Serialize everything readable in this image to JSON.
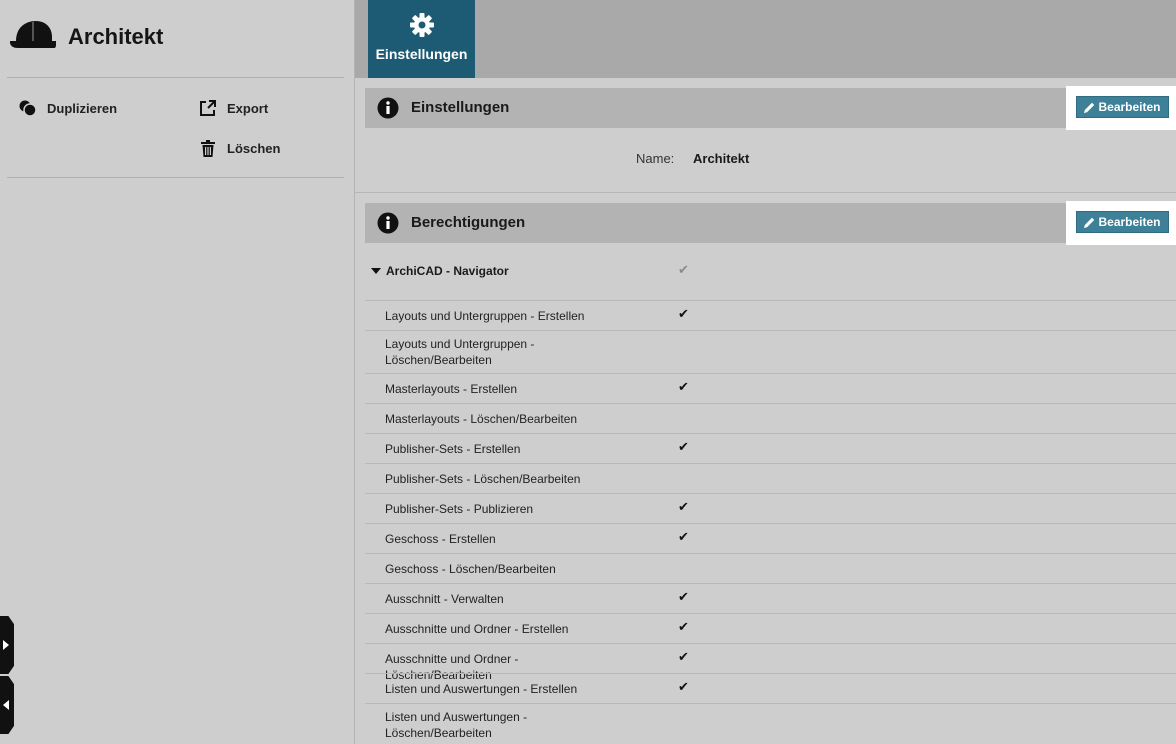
{
  "sidebar": {
    "title": "Architekt",
    "actions": {
      "duplicate": "Duplizieren",
      "export": "Export",
      "delete": "Löschen"
    }
  },
  "tabs": [
    {
      "label": "Einstellungen",
      "icon": "gear-icon",
      "active": true
    }
  ],
  "settings": {
    "title": "Einstellungen",
    "edit_label": "Bearbeiten",
    "name_label": "Name:",
    "name_value": "Architekt"
  },
  "permissions": {
    "title": "Berechtigungen",
    "edit_label": "Bearbeiten",
    "group": {
      "label": "ArchiCAD - Navigator",
      "checked": true
    },
    "items": [
      {
        "label": "Layouts und Untergruppen - Erstellen",
        "checked": true
      },
      {
        "label": "Layouts und Untergruppen - Löschen/Bearbeiten",
        "checked": false
      },
      {
        "label": "Masterlayouts - Erstellen",
        "checked": true
      },
      {
        "label": "Masterlayouts - Löschen/Bearbeiten",
        "checked": false
      },
      {
        "label": "Publisher-Sets - Erstellen",
        "checked": true
      },
      {
        "label": "Publisher-Sets - Löschen/Bearbeiten",
        "checked": false
      },
      {
        "label": "Publisher-Sets - Publizieren",
        "checked": true
      },
      {
        "label": "Geschoss - Erstellen",
        "checked": true
      },
      {
        "label": "Geschoss - Löschen/Bearbeiten",
        "checked": false
      },
      {
        "label": "Ausschnitt - Verwalten",
        "checked": true
      },
      {
        "label": "Ausschnitte und Ordner - Erstellen",
        "checked": true
      },
      {
        "label": "Ausschnitte und Ordner - Löschen/Bearbeiten",
        "checked": true
      },
      {
        "label": "Listen und Auswertungen - Erstellen",
        "checked": true
      },
      {
        "label": "Listen und Auswertungen - Löschen/Bearbeiten",
        "checked": false
      }
    ]
  },
  "icons": {
    "header": "hard-hat-icon",
    "duplicate": "duplicate-icon",
    "export": "export-icon",
    "delete": "trash-icon",
    "info": "info-icon",
    "edit": "pencil-icon",
    "check": "checkmark-icon"
  },
  "colors": {
    "accent": "#1c5b73",
    "button": "#3d8098",
    "background": "#cecece",
    "section_header": "#b3b3b3"
  }
}
